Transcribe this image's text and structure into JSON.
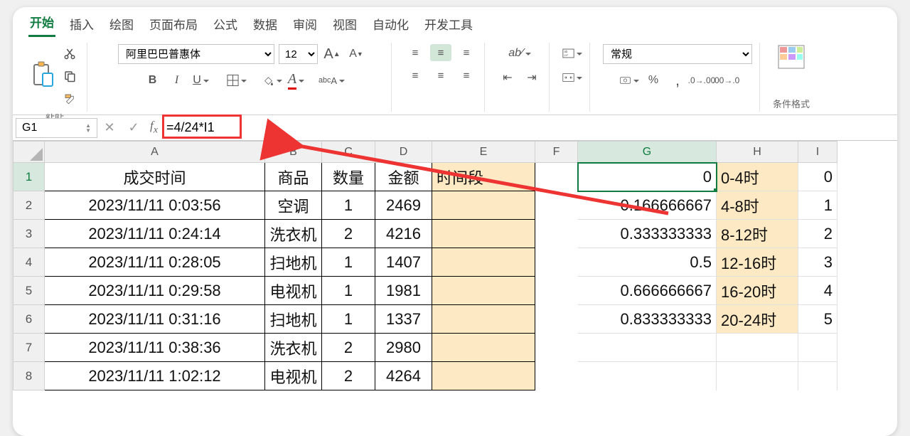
{
  "ribbon_tabs": {
    "start": "开始",
    "insert": "插入",
    "draw": "绘图",
    "layout": "页面布局",
    "formula": "公式",
    "data": "数据",
    "review": "审阅",
    "view": "视图",
    "automate": "自动化",
    "developer": "开发工具"
  },
  "ribbon": {
    "paste_label": "粘贴",
    "font_name": "阿里巴巴普惠体",
    "font_size": "12",
    "number_format": "常规",
    "cond_format_label": "条件格式"
  },
  "formula_bar": {
    "name_box": "G1",
    "formula": "=4/24*I1"
  },
  "columns": [
    "A",
    "B",
    "C",
    "D",
    "E",
    "F",
    "G",
    "H",
    "I"
  ],
  "headers": {
    "A": "成交时间",
    "B": "商品",
    "C": "数量",
    "D": "金额",
    "E": "时间段"
  },
  "rows": [
    {
      "n": 1,
      "A": "成交时间",
      "B": "商品",
      "C": "数量",
      "D": "金额",
      "E": "时间段",
      "F": "",
      "G": "0",
      "H": "0-4时",
      "I": "0"
    },
    {
      "n": 2,
      "A": "2023/11/11 0:03:56",
      "B": "空调",
      "C": "1",
      "D": "2469",
      "E": "",
      "F": "",
      "G": "0.166666667",
      "H": "4-8时",
      "I": "1"
    },
    {
      "n": 3,
      "A": "2023/11/11 0:24:14",
      "B": "洗衣机",
      "C": "2",
      "D": "4216",
      "E": "",
      "F": "",
      "G": "0.333333333",
      "H": "8-12时",
      "I": "2"
    },
    {
      "n": 4,
      "A": "2023/11/11 0:28:05",
      "B": "扫地机",
      "C": "1",
      "D": "1407",
      "E": "",
      "F": "",
      "G": "0.5",
      "H": "12-16时",
      "I": "3"
    },
    {
      "n": 5,
      "A": "2023/11/11 0:29:58",
      "B": "电视机",
      "C": "1",
      "D": "1981",
      "E": "",
      "F": "",
      "G": "0.666666667",
      "H": "16-20时",
      "I": "4"
    },
    {
      "n": 6,
      "A": "2023/11/11 0:31:16",
      "B": "扫地机",
      "C": "1",
      "D": "1337",
      "E": "",
      "F": "",
      "G": "0.833333333",
      "H": "20-24时",
      "I": "5"
    },
    {
      "n": 7,
      "A": "2023/11/11 0:38:36",
      "B": "洗衣机",
      "C": "2",
      "D": "2980",
      "E": "",
      "F": "",
      "G": "",
      "H": "",
      "I": ""
    },
    {
      "n": 8,
      "A": "2023/11/11 1:02:12",
      "B": "电视机",
      "C": "2",
      "D": "4264",
      "E": "",
      "F": "",
      "G": "",
      "H": "",
      "I": ""
    }
  ]
}
